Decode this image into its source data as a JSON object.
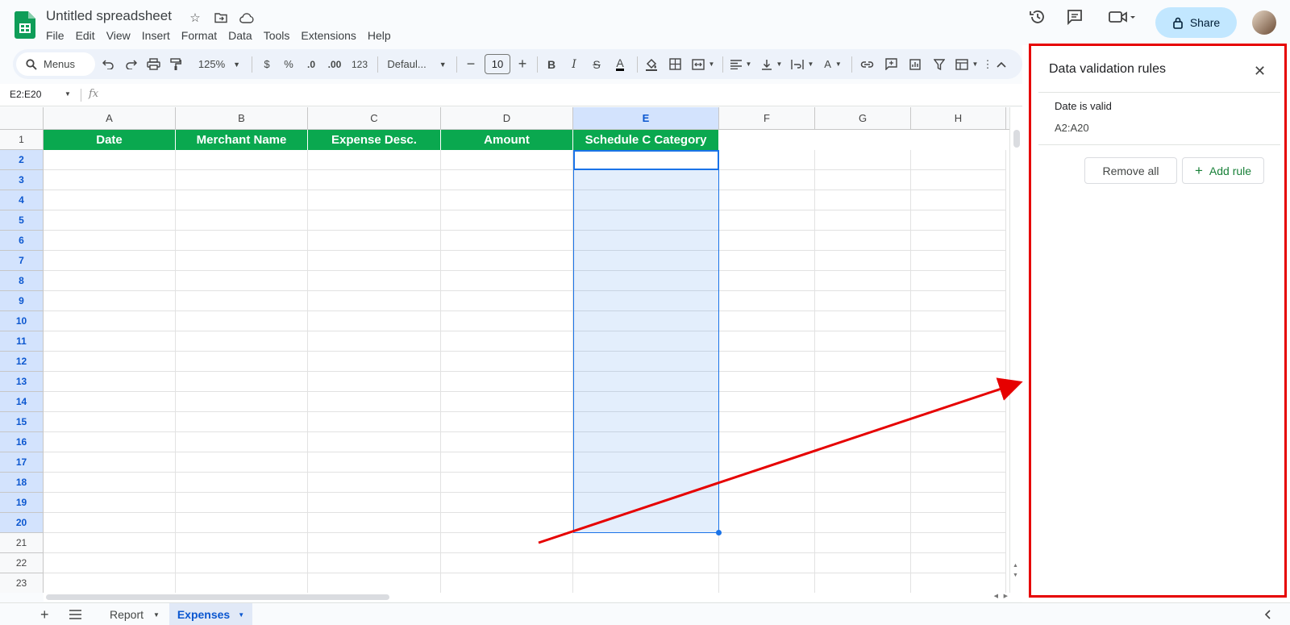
{
  "app": {
    "title": "Untitled spreadsheet"
  },
  "menu": [
    "File",
    "Edit",
    "View",
    "Insert",
    "Format",
    "Data",
    "Tools",
    "Extensions",
    "Help"
  ],
  "share_label": "Share",
  "toolbar": {
    "menus_label": "Menus",
    "zoom": "125%",
    "currency": "$",
    "percent": "%",
    "dec_dec": ".0",
    "inc_dec": ".00",
    "number_format": "123",
    "font": "Defaul...",
    "font_size": "10"
  },
  "formula_bar": {
    "name_box": "E2:E20",
    "fx": "fx"
  },
  "columns": [
    "A",
    "B",
    "C",
    "D",
    "E",
    "F",
    "G",
    "H"
  ],
  "rows": [
    "1",
    "2",
    "3",
    "4",
    "5",
    "6",
    "7",
    "8",
    "9",
    "10",
    "11",
    "12",
    "13",
    "14",
    "15",
    "16",
    "17",
    "18",
    "19",
    "20",
    "21",
    "22",
    "23"
  ],
  "header_cells": [
    "Date",
    "Merchant Name",
    "Expense Desc.",
    "Amount",
    "Schedule C Category"
  ],
  "sheets": {
    "inactive": "Report",
    "active": "Expenses"
  },
  "panel": {
    "title": "Data validation rules",
    "rule_name": "Date is valid",
    "rule_range": "A2:A20",
    "remove_all": "Remove all",
    "add_rule": "Add rule"
  },
  "colors": {
    "header_green": "#0aa84f",
    "selection_blue": "#1a73e8",
    "annotation_red": "#e60000",
    "share_bg": "#c2e7ff"
  }
}
